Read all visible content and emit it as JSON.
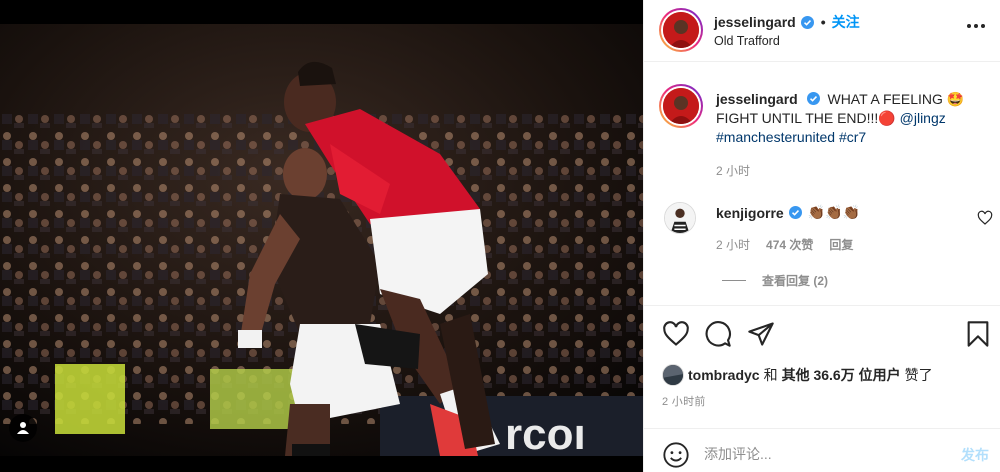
{
  "post": {
    "username": "jesselingard",
    "verified": true,
    "follow_label": "关注",
    "location": "Old Trafford",
    "photo_alt": "Two footballers celebrating in front of a crowd at a night match",
    "photo_kit_text": "Manchester United home kit",
    "caption": {
      "username": "jesselingard",
      "line1": "WHAT A FEELING 🤩",
      "line2": "FIGHT UNTIL THE END!!!🔴",
      "mention": "@jlingz",
      "hashtag1": "#manchesterunited",
      "hashtag2": "#cr7",
      "time": "2 小时"
    },
    "comment": {
      "username": "kenjigorre",
      "verified": true,
      "text": "👏🏾👏🏾👏🏾",
      "time": "2 小时",
      "likes": "474 次赞",
      "reply_label": "回复",
      "view_replies": "查看回复 (2)"
    },
    "likes": {
      "user": "tombradyc",
      "and": "和",
      "others": "其他 36.6万 位用户",
      "suffix": "赞了"
    },
    "post_time": "2 小时前",
    "composer": {
      "placeholder": "添加评论...",
      "post_label": "发布"
    }
  },
  "icons": {
    "more": "more-options-icon",
    "heart": "heart-icon",
    "comment": "comment-icon",
    "share": "share-icon",
    "save": "bookmark-icon",
    "emoji": "emoji-icon",
    "user_tag": "user-tag-icon"
  },
  "colors": {
    "accent_blue": "#0095f6",
    "link_blue": "#00376b",
    "muted": "#8e8e8e",
    "kit_red": "#d0112b"
  }
}
